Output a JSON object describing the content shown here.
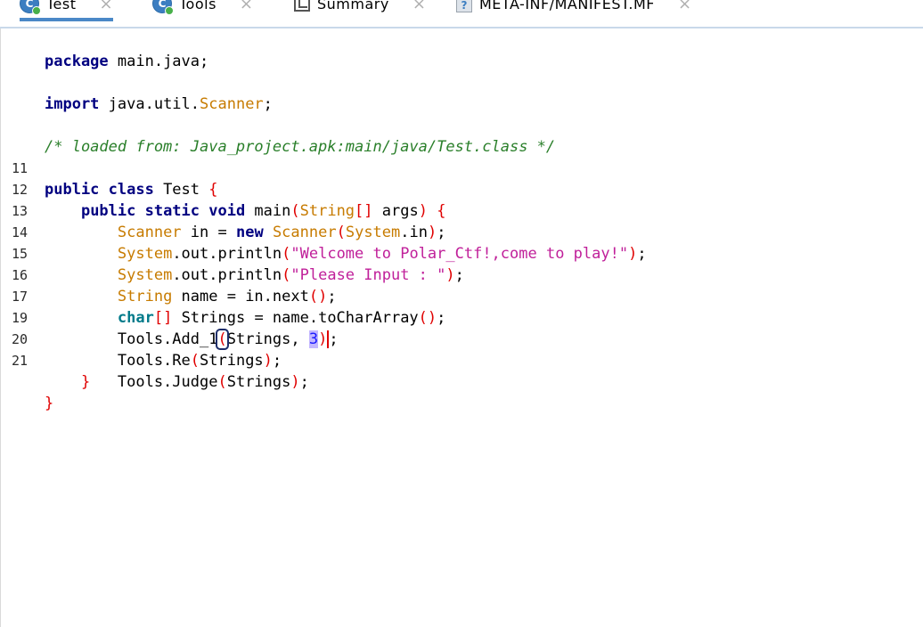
{
  "tabs": [
    {
      "label": "Test",
      "icon": "class-icon",
      "icon_letter": "C",
      "active": true
    },
    {
      "label": "Tools",
      "icon": "class-icon",
      "icon_letter": "C",
      "active": false
    },
    {
      "label": "Summary",
      "icon": "summary-icon",
      "active": false
    },
    {
      "label": "META-INF/MANIFEST.MF",
      "icon": "file-icon",
      "icon_letter": "?",
      "active": false
    }
  ],
  "close_glyph": "×",
  "code": {
    "package_kw": "package",
    "package_name": " main.java;",
    "import_kw": "import",
    "import_pre": " java.util.",
    "import_cls": "Scanner",
    "import_end": ";",
    "comment": "/* loaded from: Java_project.apk:main/java/Test.class */",
    "lines": {
      "l11": "11",
      "l12": "12",
      "l13": "13",
      "l14": "14",
      "l15": "15",
      "l16": "16",
      "l17": "17",
      "l19": "19",
      "l20": "20",
      "l21": "21"
    },
    "string_welcome": "\"Welcome to Polar_Ctf!,come to play!\"",
    "string_input": "\"Please Input : \"",
    "number_3": "3"
  }
}
